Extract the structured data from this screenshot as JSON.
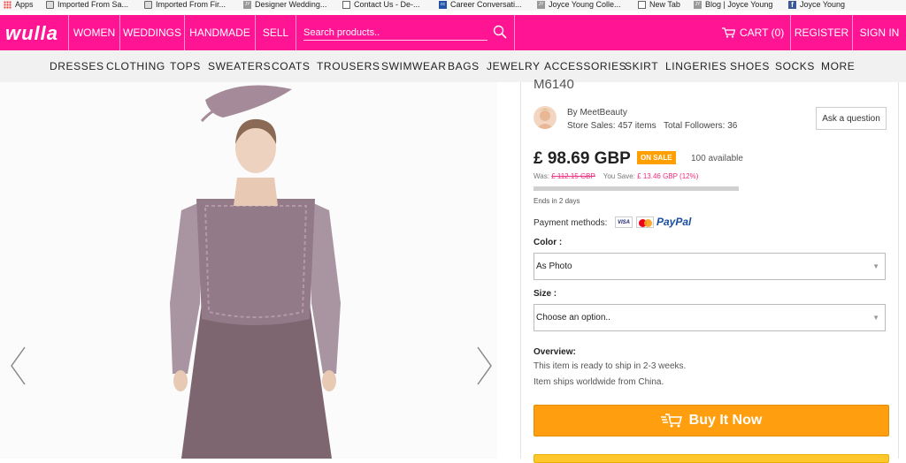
{
  "bookmarks": [
    {
      "label": "Apps",
      "icon": "apps-icon"
    },
    {
      "label": "Imported From Sa...",
      "icon": "folder-icon"
    },
    {
      "label": "Imported From Fir...",
      "icon": "folder-icon"
    },
    {
      "label": "Designer Wedding...",
      "icon": "jy-icon"
    },
    {
      "label": "Contact Us - De-...",
      "icon": "page-icon"
    },
    {
      "label": "Career Conversati...",
      "icon": "career-icon"
    },
    {
      "label": "Joyce Young Colle...",
      "icon": "jy-icon"
    },
    {
      "label": "New Tab",
      "icon": "page-icon"
    },
    {
      "label": "Blog | Joyce Young",
      "icon": "jy-icon"
    },
    {
      "label": "Joyce Young",
      "icon": "facebook-icon"
    }
  ],
  "header": {
    "logo": "wulla",
    "nav": [
      "WOMEN",
      "WEDDINGS",
      "HANDMADE",
      "SELL"
    ],
    "search_placeholder": "Search products..",
    "cart_label": "CART (0)",
    "register": "REGISTER",
    "signin": "SIGN IN",
    "brand_color": "#ff1493"
  },
  "categories": [
    "DRESSES",
    "CLOTHING",
    "TOPS",
    "SWEATERS",
    "COATS",
    "TROUSERS",
    "SWIMWEAR",
    "BAGS",
    "JEWELRY",
    "ACCESSORIES",
    "SKIRT",
    "LINGERIES",
    "SHOES",
    "SOCKS",
    "MORE"
  ],
  "product": {
    "sku": "M6140",
    "seller_prefix": "By",
    "seller": "MeetBeauty",
    "store_sales": "Store Sales: 457 items",
    "followers": "Total Followers: 36",
    "ask_button": "Ask a question",
    "price": "£ 98.69 GBP",
    "sale_badge": "ON SALE",
    "available": "100 available",
    "was_label": "Was:",
    "was_price": "£ 112.15 GBP",
    "save_label": "You Save:",
    "save_amount": "£ 13.46 GBP (12%)",
    "ends": "Ends in 2 days",
    "payment_label": "Payment methods:",
    "payment_icons": [
      "visa-icon",
      "mastercard-icon",
      "paypal-icon"
    ],
    "paypal_text": "PayPal",
    "visa_text": "VISA",
    "color_label": "Color :",
    "color_value": "As Photo",
    "size_label": "Size :",
    "size_value": "Choose an option..",
    "overview_title": "Overview:",
    "overview_lines": [
      "This item is ready to ship in 2-3 weeks.",
      "Item ships worldwide from China."
    ],
    "buy_label": "Buy It Now",
    "accent_color": "#ff9f0f"
  }
}
